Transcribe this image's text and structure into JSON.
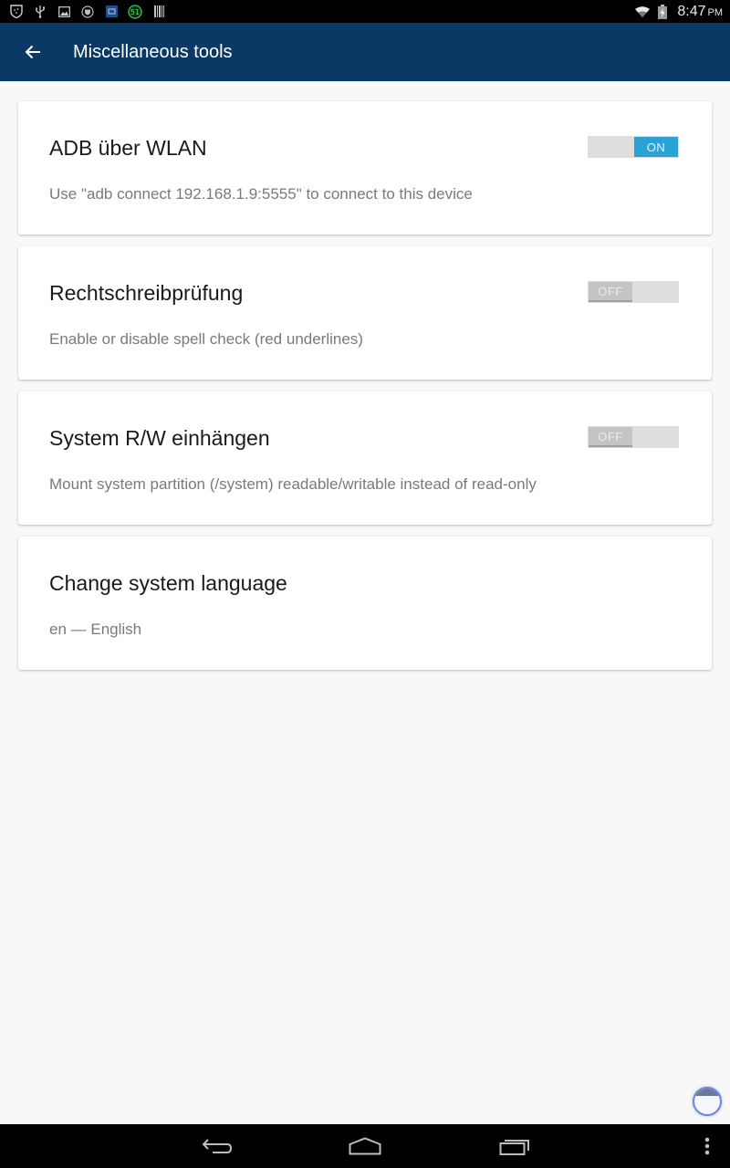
{
  "status_bar": {
    "left_icons": [
      "shield-icon",
      "usb-icon",
      "image-icon",
      "vpn-shield-icon",
      "app-notification-icon",
      "badge-51-icon",
      "barcode-icon"
    ],
    "badge_count": "51",
    "right_icons": [
      "wifi-icon",
      "battery-charging-icon"
    ],
    "time": "8:47",
    "ampm": "PM"
  },
  "app_bar": {
    "back_icon": "arrow-left-icon",
    "title": "Miscellaneous tools"
  },
  "settings": [
    {
      "title": "ADB über WLAN",
      "subtitle": "Use \"adb connect 192.168.1.9:5555\" to connect to this device",
      "toggle": {
        "state": "on",
        "label": "ON"
      }
    },
    {
      "title": "Rechtschreibprüfung",
      "subtitle": "Enable or disable spell check (red underlines)",
      "toggle": {
        "state": "off",
        "label": "OFF"
      }
    },
    {
      "title": "System R/W einhängen",
      "subtitle": "Mount system partition (/system) readable/writable instead of read-only",
      "toggle": {
        "state": "off",
        "label": "OFF"
      }
    },
    {
      "title": "Change system language",
      "subtitle": "en — English"
    }
  ],
  "colors": {
    "app_bar": "#0a3966",
    "toggle_on": "#2aa3d4",
    "toggle_off": "#c4c4c4",
    "background": "#f8f8f8"
  },
  "nav_bar": {
    "buttons": [
      "back-icon",
      "home-icon",
      "recents-icon",
      "overflow-menu-icon"
    ]
  }
}
